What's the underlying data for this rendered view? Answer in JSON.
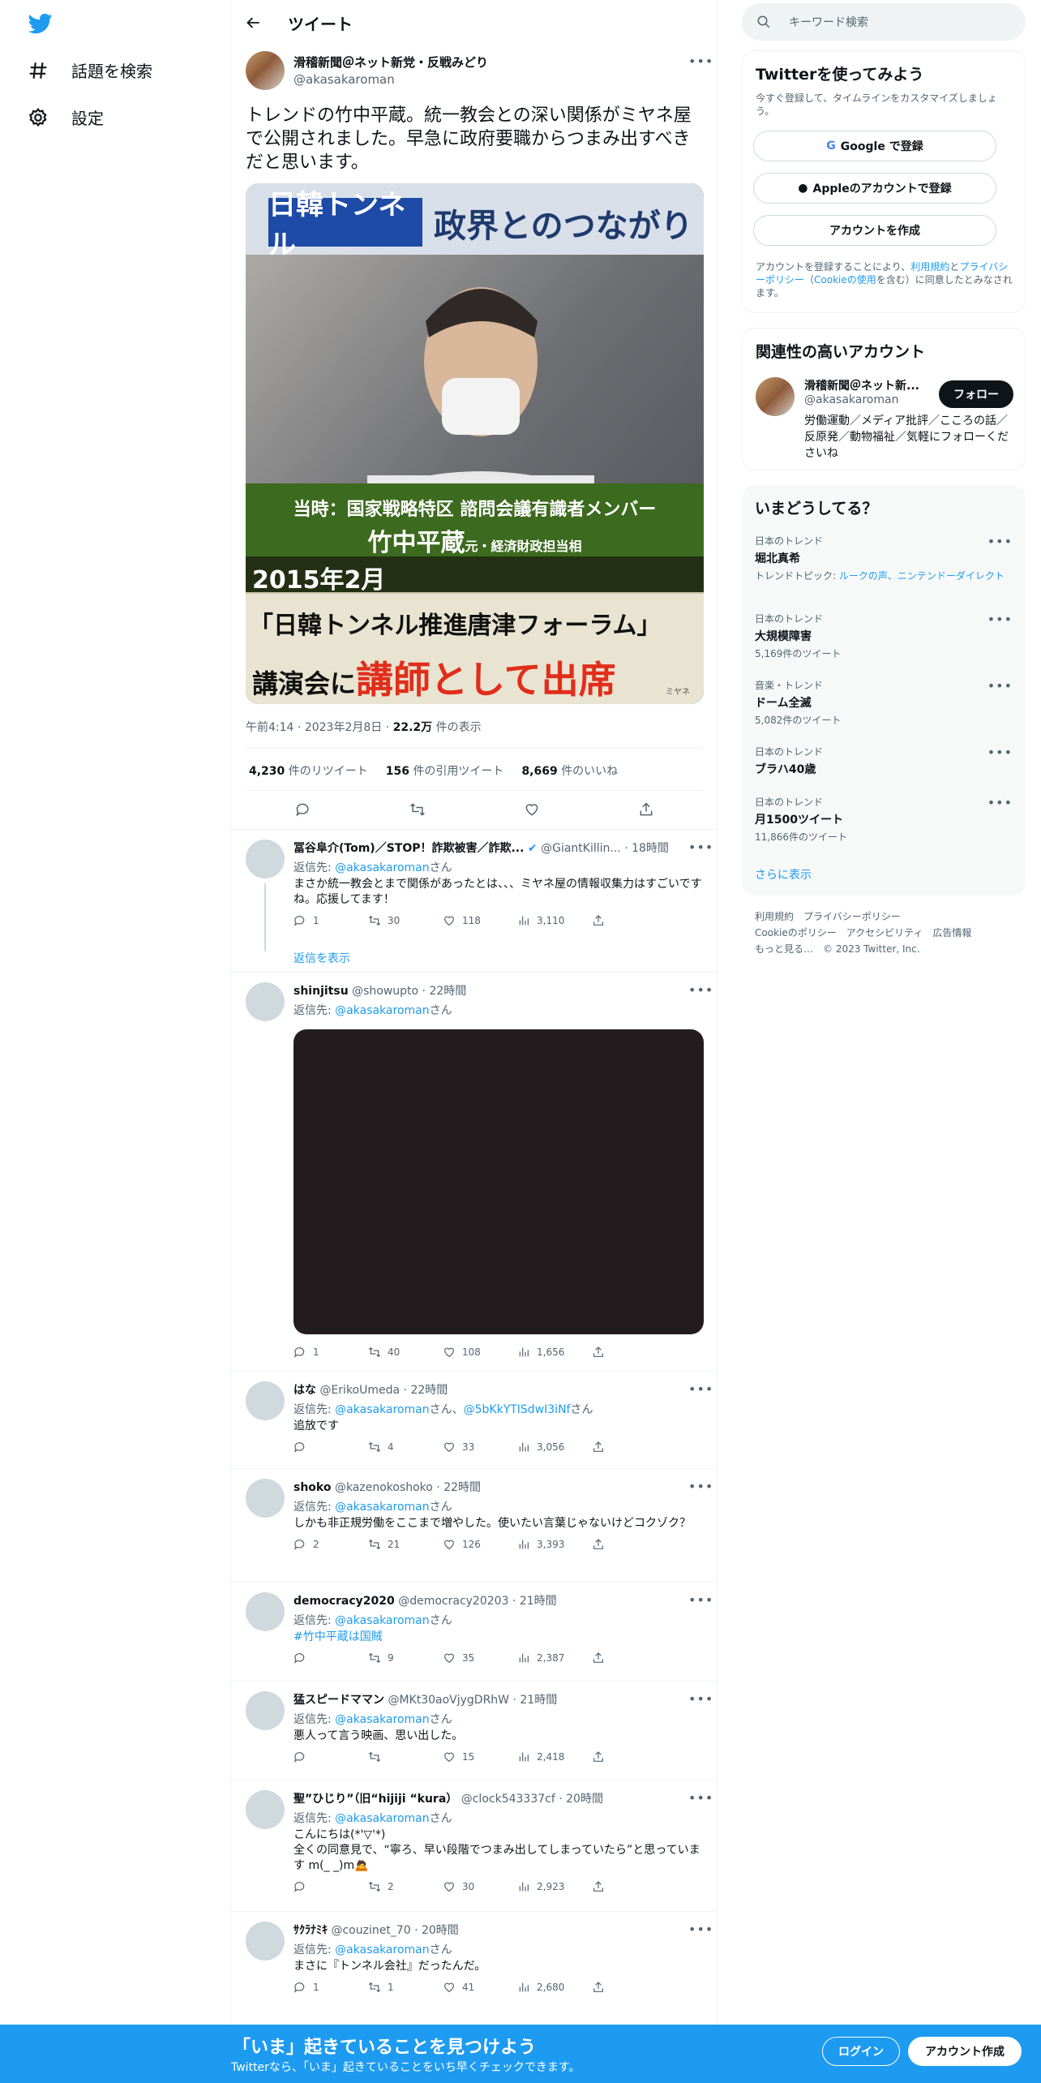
{
  "nav": {
    "explore_label": "話題を検索",
    "settings_label": "設定"
  },
  "header": {
    "back_icon": "arrow-left-icon",
    "title": "ツイート"
  },
  "tweet": {
    "name": "滑稽新聞＠ネット新党・反戦みどり",
    "handle": "@akasakaroman",
    "text": "トレンドの竹中平蔵。統一教会との深い関係がミヤネ屋で公開されました。早急に政府要職からつまみ出すべきだと思います。",
    "image": {
      "banner_left": "日韓トンネル",
      "banner_right": "政界とのつながり",
      "caption_line1": "当時：国家戦略特区 諮問会議有識者メンバー",
      "caption_name": "竹中平蔵",
      "caption_title": "元・経済財政担当相",
      "caption_date": "2015年2月",
      "caption_event": "「日韓トンネル推進唐津フォーラム」",
      "caption_action_prefix": "講演会に",
      "caption_action_red": "講師として出席",
      "watermark": "ミヤネ"
    },
    "time": "午前4:14",
    "date": "2023年2月8日",
    "views": "22.2万",
    "views_suffix": "件の表示",
    "retweets": "4,230",
    "retweets_label": "件のリツイート",
    "quotes": "156",
    "quotes_label": "件の引用ツイート",
    "likes": "8,669",
    "likes_label": "件のいいね"
  },
  "replies": [
    {
      "name": "冨谷阜介(Tom)／STOP！詐欺被害／詐欺...",
      "handle": "@GiantKillin...",
      "time": "18時間",
      "reply_to_prefix": "返信先: ",
      "reply_to": "@akasakaroman",
      "reply_to_suffix": "さん",
      "text": "まさか統一教会とまで関係があったとは、、、ミヤネ屋の情報収集力はすごいですね。応援してます！",
      "replies": "1",
      "retweets": "30",
      "likes": "118",
      "views": "3,110",
      "show_replies": "返信を表示"
    },
    {
      "name": "shinjitsu",
      "handle": "@showupto",
      "time": "22時間",
      "reply_to_prefix": "返信先: ",
      "reply_to": "@akasakaroman",
      "reply_to_suffix": "さん",
      "replies": "1",
      "retweets": "40",
      "likes": "108",
      "views": "1,656"
    },
    {
      "name": "はな",
      "handle": "@ErikoUmeda",
      "time": "22時間",
      "reply_to_prefix": "返信先: ",
      "reply_to": "@akasakaroman",
      "reply_to_mid": "さん、",
      "reply_to_2": "@5bKkYTISdwI3iNf",
      "reply_to_suffix": "さん",
      "text": "追放です",
      "replies": "",
      "retweets": "4",
      "likes": "33",
      "views": "3,056"
    },
    {
      "name": "shoko",
      "handle": "@kazenokoshoko",
      "time": "22時間",
      "reply_to_prefix": "返信先: ",
      "reply_to": "@akasakaroman",
      "reply_to_suffix": "さん",
      "text": "しかも非正規労働をここまで増やした。使いたい言葉じゃないけどコクゾク？",
      "replies": "2",
      "retweets": "21",
      "likes": "126",
      "views": "3,393"
    },
    {
      "name": "democracy2020",
      "handle": "@democracy20203",
      "time": "21時間",
      "reply_to_prefix": "返信先: ",
      "reply_to": "@akasakaroman",
      "reply_to_suffix": "さん",
      "text": "#竹中平蔵は国賊",
      "replies": "",
      "retweets": "9",
      "likes": "35",
      "views": "2,387"
    },
    {
      "name": "猛スピードママン",
      "handle": "@MKt30aoVjygDRhW",
      "time": "21時間",
      "reply_to_prefix": "返信先: ",
      "reply_to": "@akasakaroman",
      "reply_to_suffix": "さん",
      "text": "悪人って言う映画、思い出した。",
      "replies": "",
      "retweets": "",
      "likes": "15",
      "views": "2,418"
    },
    {
      "name": "聖”ひじり”（旧“hijiji “kura）",
      "handle": "@clock543337cf",
      "time": "20時間",
      "reply_to_prefix": "返信先: ",
      "reply_to": "@akasakaroman",
      "reply_to_suffix": "さん",
      "text": "こんにちは(*'▽'*)\n全くの同意見で、“寧ろ、早い段階でつまみ出してしまっていたら”と思っています m(_ _)m🙇",
      "replies": "",
      "retweets": "2",
      "likes": "30",
      "views": "2,923"
    },
    {
      "name": "ｻｸﾗﾅﾐｷ",
      "handle": "@couzinet_70",
      "time": "20時間",
      "reply_to_prefix": "返信先: ",
      "reply_to": "@akasakaroman",
      "reply_to_suffix": "さん",
      "text": "まさに『トンネル会社』だったんだ。",
      "replies": "1",
      "retweets": "1",
      "likes": "41",
      "views": "2,680"
    }
  ],
  "right": {
    "search_placeholder": "キーワード検索",
    "signup_card": {
      "title": "Twitterを使ってみよう",
      "subtitle": "今すぐ登録して、タイムラインをカスタマイズしましょう。",
      "google_label": "Google で登録",
      "apple_label": "Appleのアカウントで登録",
      "create_label": "アカウントを作成",
      "terms_prefix": "アカウントを登録することにより、",
      "terms_link": "利用規約",
      "terms_and": "と",
      "privacy_link": "プライバシーポリシー",
      "paren_open": "（",
      "cookie_link": "Cookieの使用",
      "terms_suffix": "を含む）に同意したとみなされます。"
    },
    "related": {
      "title": "関連性の高いアカウント",
      "name": "滑稽新聞＠ネット新...",
      "handle": "@akasakaroman",
      "follow_label": "フォロー",
      "bio": "労働運動／メディア批評／こころの話／反原発／動物福祉／気軽にフォローくださいね"
    },
    "trends": {
      "title": "いまどうしてる？",
      "items": [
        {
          "category": "日本のトレンド",
          "topic": "堀北真希",
          "extra_prefix": "トレンドトピック: ",
          "extra_link": "ルークの声、ニンテンドーダイレクト"
        },
        {
          "category": "日本のトレンド",
          "topic": "大規模障害",
          "count": "5,169件のツイート"
        },
        {
          "category": "音楽・トレンド",
          "topic": "ドーム全滅",
          "count": "5,082件のツイート"
        },
        {
          "category": "日本のトレンド",
          "topic": "ブラハ40歳"
        },
        {
          "category": "日本のトレンド",
          "topic": "月1500ツイート",
          "count": "11,866件のツイート"
        }
      ],
      "show_more": "さらに表示"
    },
    "footer": {
      "line1": "利用規約　プライバシーポリシー",
      "line2": "Cookieのポリシー　アクセシビリティ　広告情報",
      "line3": "もっと見る…　© 2023 Twitter, Inc."
    }
  },
  "banner": {
    "headline": "「いま」起きていることを見つけよう",
    "sub": "Twitterなら、「いま」起きていることをいち早くチェックできます。",
    "login_label": "ログイン",
    "signup_label": "アカウント作成"
  },
  "colors": {
    "accent": "#1d9bf0",
    "text": "#0f1419",
    "muted": "#536471",
    "border": "#eff3f4"
  }
}
